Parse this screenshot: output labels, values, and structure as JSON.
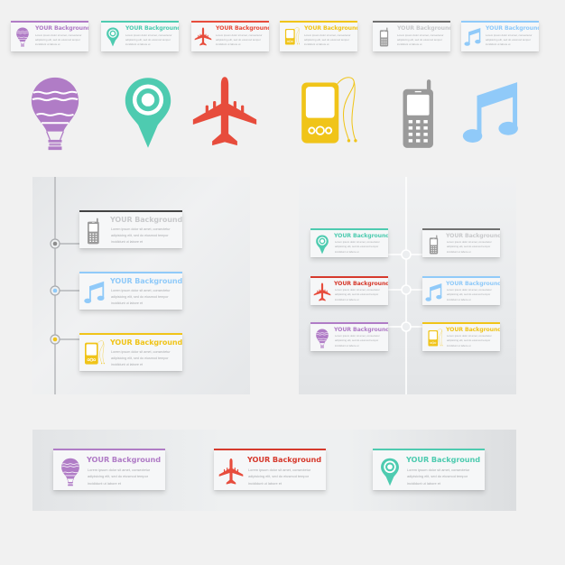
{
  "card_text": {
    "title": "YOUR Background",
    "body": "Lorem ipsum dolor sit amet, consectetur adipisicing elit, sed do eiusmod tempor incididunt ut labore et"
  },
  "colors": {
    "purple": "#b07cc6",
    "teal": "#4ecbb0",
    "red": "#e74c3c",
    "yellow": "#f0c419",
    "gray": "#9a9a9a",
    "gray_bar": "#555555",
    "blue": "#90caf9",
    "background": "#f1f1f1"
  },
  "top_row": [
    {
      "icon": "hot-air-balloon-icon",
      "color": "purple"
    },
    {
      "icon": "map-pin-icon",
      "color": "teal"
    },
    {
      "icon": "airplane-icon",
      "color": "red"
    },
    {
      "icon": "mp3-player-icon",
      "color": "yellow"
    },
    {
      "icon": "mobile-phone-icon",
      "color": "gray"
    },
    {
      "icon": "music-note-icon",
      "color": "blue"
    }
  ],
  "large_icons": [
    {
      "icon": "hot-air-balloon-icon",
      "color": "purple"
    },
    {
      "icon": "map-pin-icon",
      "color": "teal"
    },
    {
      "icon": "airplane-icon",
      "color": "red"
    },
    {
      "icon": "mp3-player-icon",
      "color": "yellow"
    },
    {
      "icon": "mobile-phone-icon",
      "color": "gray"
    },
    {
      "icon": "music-note-icon",
      "color": "blue"
    }
  ],
  "left_timeline": [
    {
      "icon": "mobile-phone-icon",
      "color": "gray"
    },
    {
      "icon": "music-note-icon",
      "color": "blue"
    },
    {
      "icon": "mp3-player-icon",
      "color": "yellow"
    }
  ],
  "right_grid": {
    "left_column": [
      {
        "icon": "map-pin-icon",
        "color": "teal"
      },
      {
        "icon": "airplane-icon",
        "color": "red"
      },
      {
        "icon": "hot-air-balloon-icon",
        "color": "purple"
      }
    ],
    "right_column": [
      {
        "icon": "mobile-phone-icon",
        "color": "gray"
      },
      {
        "icon": "music-note-icon",
        "color": "blue"
      },
      {
        "icon": "mp3-player-icon",
        "color": "yellow"
      }
    ]
  },
  "bottom_row": [
    {
      "icon": "hot-air-balloon-icon",
      "color": "purple"
    },
    {
      "icon": "airplane-icon",
      "color": "red"
    },
    {
      "icon": "map-pin-icon",
      "color": "teal"
    }
  ]
}
